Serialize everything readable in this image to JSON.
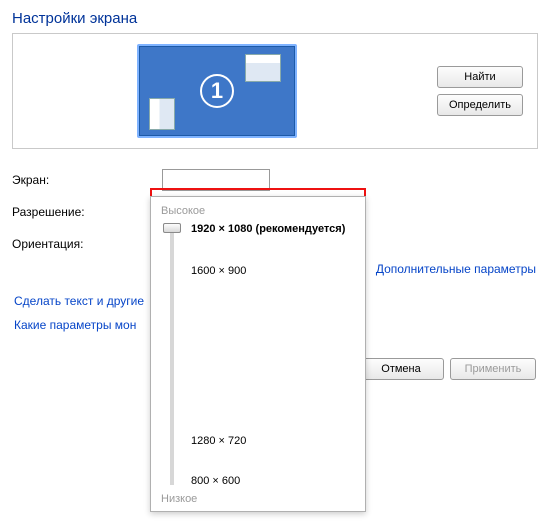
{
  "title": "Настройки экрана",
  "display": {
    "number": "1"
  },
  "buttons": {
    "find": "Найти",
    "identify": "Определить",
    "cancel": "Отмена",
    "apply": "Применить"
  },
  "labels": {
    "screen": "Экран:",
    "resolution": "Разрешение:",
    "orientation": "Ориентация:"
  },
  "resolution": {
    "selected": "1920 × 1080 (рекомендуется)",
    "header": "Высокое",
    "footer": "Низкое",
    "options": [
      {
        "label": "1920 × 1080 (рекомендуется)",
        "pos": 0,
        "selected": true
      },
      {
        "label": "1600 × 900",
        "pos": 42
      },
      {
        "label": "1280 × 720",
        "pos": 212
      },
      {
        "label": "800 × 600",
        "pos": 252
      }
    ]
  },
  "links": {
    "advanced": "Дополнительные параметры",
    "text_size": "Сделать текст и другие",
    "which_params": "Какие параметры мон"
  }
}
